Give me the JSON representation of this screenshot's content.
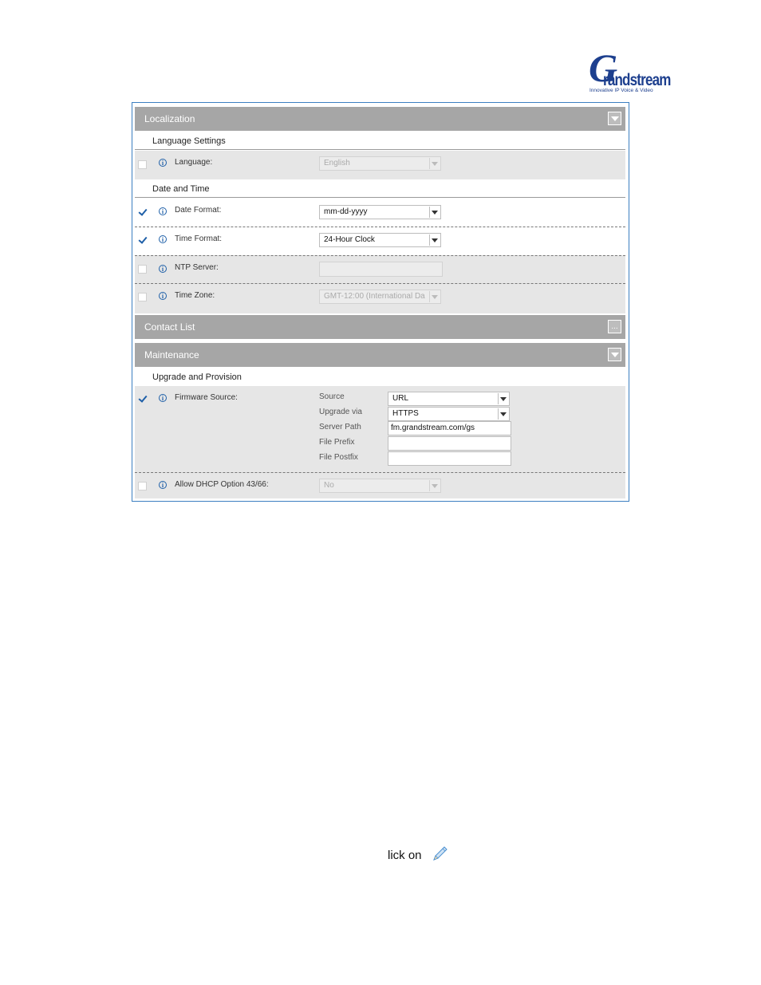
{
  "logo": {
    "initial": "G",
    "wordmark": "randstream",
    "tagline": "Innovative IP Voice & Video"
  },
  "sections": {
    "localization": {
      "title": "Localization",
      "button": "collapse"
    },
    "contact_list": {
      "title": "Contact List",
      "button": "..."
    },
    "maintenance": {
      "title": "Maintenance",
      "button": "collapse"
    }
  },
  "language_settings": {
    "header": "Language Settings",
    "language": {
      "label": "Language:",
      "value": "English",
      "checked": false,
      "enabled": false
    }
  },
  "date_time": {
    "header": "Date and Time",
    "date_format": {
      "label": "Date Format:",
      "value": "mm-dd-yyyy",
      "checked": true
    },
    "time_format": {
      "label": "Time Format:",
      "value": "24-Hour Clock",
      "checked": true
    },
    "ntp_server": {
      "label": "NTP Server:",
      "value": "",
      "checked": false,
      "enabled": false
    },
    "time_zone": {
      "label": "Time Zone:",
      "value": "GMT-12:00 (International Da",
      "checked": false,
      "enabled": false
    }
  },
  "upgrade": {
    "header": "Upgrade and Provision",
    "firmware_source": {
      "label": "Firmware Source:",
      "checked": true,
      "source_label": "Source",
      "source_value": "URL",
      "upgrade_via_label": "Upgrade via",
      "upgrade_via_value": "HTTPS",
      "server_path_label": "Server Path",
      "server_path_value": "fm.grandstream.com/gs",
      "file_prefix_label": "File Prefix",
      "file_prefix_value": "",
      "file_postfix_label": "File Postfix",
      "file_postfix_value": ""
    },
    "dhcp_option": {
      "label": "Allow DHCP Option 43/66:",
      "value": "No",
      "checked": false,
      "enabled": false
    }
  },
  "footer": {
    "text": "lick on",
    "icon": "pencil-icon"
  }
}
